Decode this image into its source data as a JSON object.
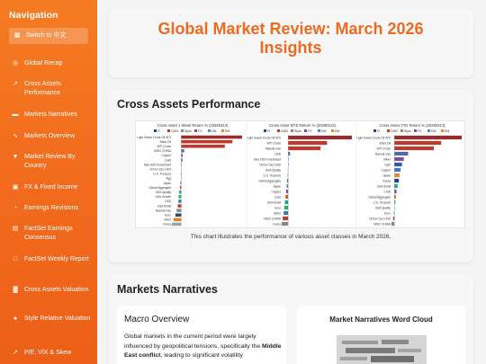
{
  "sidebar": {
    "title": "Navigation",
    "switch_label": "Switch to 中文",
    "items": [
      {
        "icon": "globe-icon",
        "glyph": "◎",
        "label": "Global Recap"
      },
      {
        "icon": "line-chart-icon",
        "glyph": "↗",
        "label": "Cross Assets Performance"
      },
      {
        "icon": "chat-icon",
        "glyph": "▬",
        "label": "Markets Narratives"
      },
      {
        "icon": "trend-icon",
        "glyph": "∿",
        "label": "Markets Overview"
      },
      {
        "icon": "map-pin-icon",
        "glyph": "▼",
        "label": "Market Review By Country"
      },
      {
        "icon": "money-icon",
        "glyph": "▣",
        "label": "FX & Fixed Income"
      },
      {
        "icon": "cycle-icon",
        "glyph": "◔",
        "label": "Earnings Revisions"
      },
      {
        "icon": "database-icon",
        "glyph": "▤",
        "label": "FactSet Earnings Consensus"
      },
      {
        "icon": "document-icon",
        "glyph": "□",
        "label": "FactSet Weekly Report"
      },
      {
        "icon": "valuation-icon",
        "glyph": "▓",
        "label": "Cross Assets Valuation"
      },
      {
        "icon": "style-icon",
        "glyph": "●",
        "label": "Style Relative Valuation"
      },
      {
        "icon": "chart-icon",
        "glyph": "↗",
        "label": "P/E, VIX & Skew"
      }
    ]
  },
  "header": {
    "title_line1": "Global Market Review: March 2026",
    "title_line2": "Insights"
  },
  "cross_assets": {
    "heading": "Cross Assets Performance",
    "caption": "This chart illustrates the performance of various asset classes in March 2026.",
    "legend": [
      "FI",
      "CMD",
      "Style",
      "FX",
      "DM",
      "EM"
    ],
    "legend_colors": [
      "#1f3f99",
      "#c0392b",
      "#888888",
      "#7a4fa0",
      "#4a90c8",
      "#e08a2e"
    ]
  },
  "chart_data": [
    {
      "type": "bar",
      "title": "Cross Asset 1 Week Return % (20260313)",
      "categories": [
        "Light Sweet Crude Oil WTI",
        "Brent Oil",
        "WTI Crude",
        "MSCI CHINA",
        "Copper",
        "Gold",
        "Asia USD Investment",
        "China Corp USD",
        "U.S. Treasury",
        "Agg",
        "Japan",
        "Global Aggregate",
        "USA Quality",
        "USA Growth",
        "USD",
        "USA Small",
        "Natural Gas",
        "Euro",
        "Silver",
        "Korea"
      ],
      "values": [
        20.8,
        17.5,
        14.9,
        1.0,
        0.5,
        0.4,
        0.2,
        0.1,
        0.0,
        -0.1,
        -0.3,
        -0.5,
        -0.7,
        -0.9,
        -1.0,
        -1.2,
        -1.6,
        -2.0,
        -2.6,
        -3.2
      ]
    },
    {
      "type": "bar",
      "title": "Cross Asset MTD Return % (20260313)",
      "categories": [
        "Light Sweet Crude Oil WTI",
        "WTI Crude",
        "Natural Gas",
        "USD",
        "Asia USD Investment",
        "China Corp USD",
        "USA Quality",
        "U.S. Treasury",
        "Global Aggregate",
        "Japan",
        "Copper",
        "Gold",
        "USA Small",
        "Euro",
        "Silver",
        "MSCI CHINA",
        "Korea"
      ],
      "values": [
        59.0,
        36.0,
        30.0,
        1.7,
        0.4,
        0.2,
        -0.3,
        -0.6,
        -0.8,
        -1.4,
        -1.9,
        -2.4,
        -3.0,
        -3.6,
        -4.2,
        -5.1,
        -6.0
      ]
    },
    {
      "type": "bar",
      "title": "Cross Asset YTD Return % (20260313)",
      "categories": [
        "Light Sweet Crude Oil WTI",
        "Brent Oil",
        "WTI Crude",
        "Natural Gas",
        "Silver",
        "Gold",
        "Copper",
        "Japan",
        "Korea",
        "USA Small",
        "USD",
        "Global Aggregate",
        "U.S. Treasury",
        "USA Quality",
        "Euro",
        "China Corp USD",
        "MSCI CHINA"
      ],
      "values": [
        57.9,
        40.3,
        33.9,
        11.8,
        8.1,
        6.5,
        5.3,
        4.5,
        3.8,
        2.7,
        1.8,
        1.2,
        0.8,
        0.2,
        -0.5,
        -1.1,
        -2.5
      ]
    }
  ],
  "narratives": {
    "heading": "Markets Narratives",
    "macro_title": "Macro Overview",
    "macro_text_1": "Global markets in the current period were largely influenced by geopolitical tensions, specifically the ",
    "macro_bold": "Middle East conflict",
    "macro_text_2": ", leading to significant volatility",
    "wordcloud_title": "Market Narratives Word Cloud"
  }
}
